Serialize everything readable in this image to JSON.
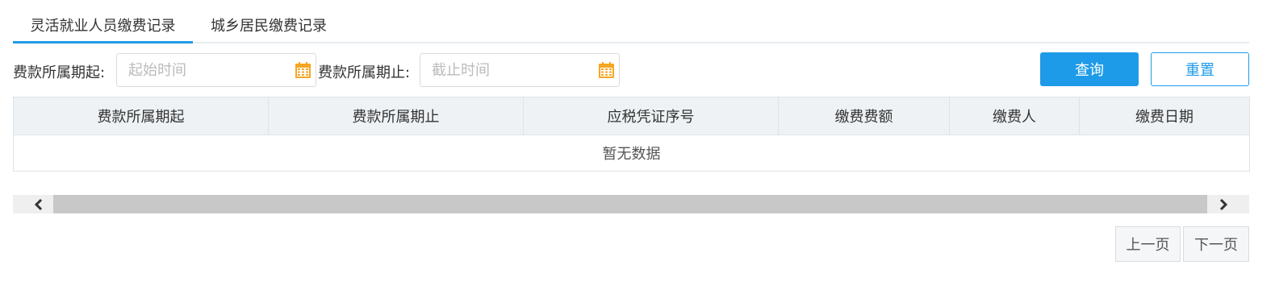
{
  "tabs": [
    {
      "label": "灵活就业人员缴费记录",
      "active": true
    },
    {
      "label": "城乡居民缴费记录",
      "active": false
    }
  ],
  "filters": {
    "start_label": "费款所属期起:",
    "start_placeholder": "起始时间",
    "start_value": "",
    "end_label": "费款所属期止:",
    "end_placeholder": "截止时间",
    "end_value": ""
  },
  "buttons": {
    "query": "查询",
    "reset": "重置"
  },
  "table": {
    "columns": [
      "费款所属期起",
      "费款所属期止",
      "应税凭证序号",
      "缴费费额",
      "缴费人",
      "缴费日期"
    ],
    "empty_text": "暂无数据"
  },
  "pager": {
    "prev": "上一页",
    "next": "下一页"
  },
  "colors": {
    "accent": "#1e9be8",
    "calendar_icon": "#f5a623"
  }
}
